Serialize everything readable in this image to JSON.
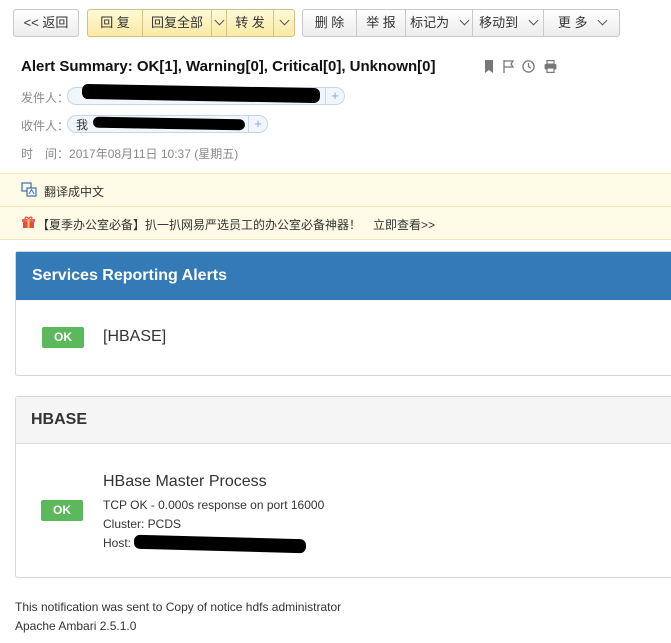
{
  "toolbar": {
    "back": "<< 返回",
    "reply": "回 复",
    "reply_all": "回复全部",
    "forward": "转 发",
    "delete": "删 除",
    "report": "举 报",
    "mark_as": "标记为",
    "move_to": "移动到",
    "more": "更 多"
  },
  "header": {
    "subject": "Alert Summary: OK[1], Warning[0], Critical[0], Unknown[0]",
    "icons": [
      "bookmark-icon",
      "flag-icon",
      "clock-icon",
      "print-icon"
    ],
    "from_label": "发件人：",
    "to_label": "收件人：",
    "to_prefix": "我",
    "plus": "+",
    "time_label": "时　间：",
    "time_value": "2017年08月11日 10:37 (星期五)"
  },
  "banners": {
    "translate": "翻译成中文",
    "promo_text": "【夏季办公室必备】扒一扒网易严选员工的办公室必备神器！",
    "promo_link": "立即查看>>"
  },
  "email": {
    "services_title": "Services Reporting Alerts",
    "services": [
      {
        "status": "OK",
        "name": "[HBASE]"
      }
    ],
    "section_title": "HBASE",
    "alert": {
      "status": "OK",
      "title": "HBase Master Process",
      "detail": "TCP OK - 0.000s response on port 16000",
      "cluster": "Cluster: PCDS",
      "host_label": "Host:"
    },
    "footer_line1": "This notification was sent to Copy of notice hdfs administrator",
    "footer_line2": "Apache Ambari 2.5.1.0"
  },
  "colors": {
    "panel_header": "#337ab7",
    "ok_badge": "#5cb85c",
    "banner_bg": "#fdfbe5",
    "link": "#1a5fb4"
  }
}
